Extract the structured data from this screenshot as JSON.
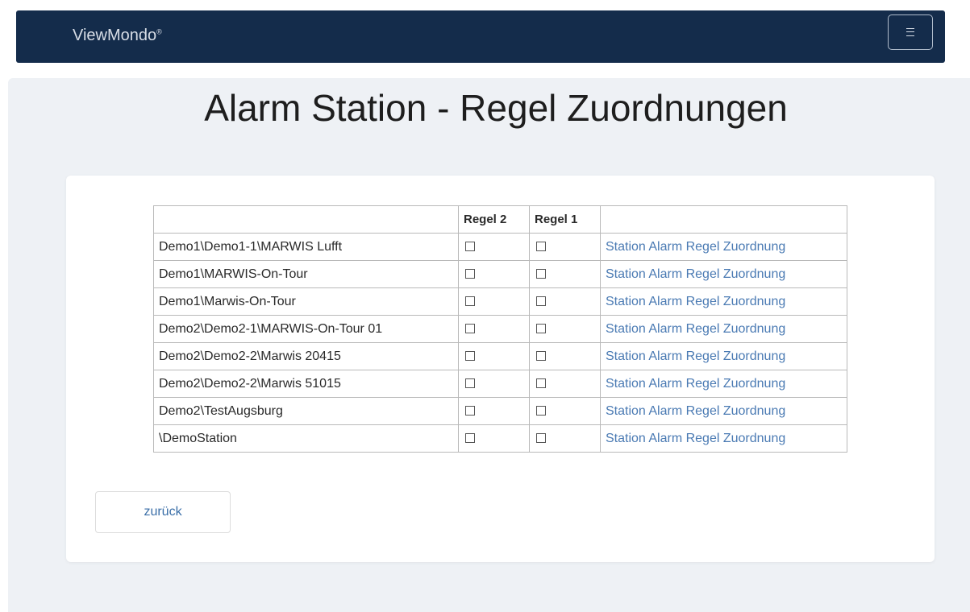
{
  "nav": {
    "brand": "ViewMondo",
    "brand_mark": "®",
    "menu_icon": "hamburger-icon"
  },
  "page": {
    "title": "Alarm Station - Regel Zuordnungen"
  },
  "table": {
    "headers": [
      "",
      "Regel 2",
      "Regel 1",
      ""
    ],
    "rows": [
      {
        "station": "Demo1\\Demo1-1\\MARWIS Lufft",
        "regel2": false,
        "regel1": false,
        "link": "Station Alarm Regel Zuordnung"
      },
      {
        "station": "Demo1\\MARWIS-On-Tour",
        "regel2": false,
        "regel1": false,
        "link": "Station Alarm Regel Zuordnung"
      },
      {
        "station": "Demo1\\Marwis-On-Tour",
        "regel2": false,
        "regel1": false,
        "link": "Station Alarm Regel Zuordnung"
      },
      {
        "station": "Demo2\\Demo2-1\\MARWIS-On-Tour 01",
        "regel2": false,
        "regel1": false,
        "link": "Station Alarm Regel Zuordnung"
      },
      {
        "station": "Demo2\\Demo2-2\\Marwis 20415",
        "regel2": false,
        "regel1": false,
        "link": "Station Alarm Regel Zuordnung"
      },
      {
        "station": "Demo2\\Demo2-2\\Marwis 51015",
        "regel2": false,
        "regel1": false,
        "link": "Station Alarm Regel Zuordnung"
      },
      {
        "station": "Demo2\\TestAugsburg",
        "regel2": false,
        "regel1": false,
        "link": "Station Alarm Regel Zuordnung"
      },
      {
        "station": "\\DemoStation",
        "regel2": false,
        "regel1": false,
        "link": "Station Alarm Regel Zuordnung"
      }
    ]
  },
  "actions": {
    "back_label": "zurück"
  },
  "colors": {
    "navbar": "#142c4b",
    "background": "#eef1f5",
    "link": "#4a7ab3"
  }
}
